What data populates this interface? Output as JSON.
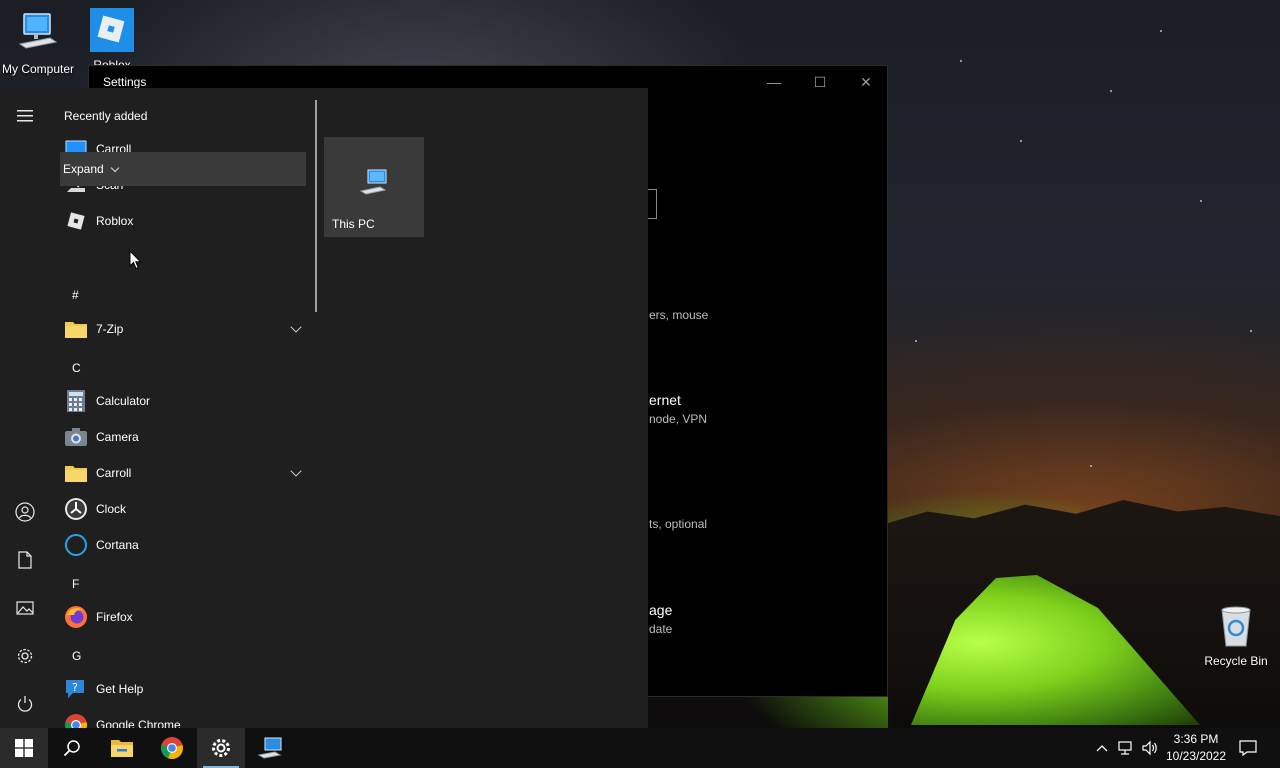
{
  "desktop": {
    "icons": [
      {
        "label": "My Computer",
        "icon": "monitor-icon"
      },
      {
        "label": "Roblox",
        "icon": "roblox-icon"
      },
      {
        "label": "Recycle Bin",
        "icon": "recycle-bin-icon"
      }
    ]
  },
  "settings_window": {
    "title": "Settings",
    "controls": {
      "minimize": "—",
      "maximize": "☐",
      "close": "✕"
    },
    "fragments": [
      "ers, mouse",
      "ernet",
      "node, VPN",
      "ts, optional",
      "age",
      "date"
    ]
  },
  "start_menu": {
    "rail": [
      "hamburger-menu-icon",
      "user-icon",
      "documents-icon",
      "pictures-icon",
      "settings-gear-icon",
      "power-icon"
    ],
    "recently_added_label": "Recently added",
    "recent": [
      {
        "label": "Carroll",
        "icon": "monitor-icon"
      },
      {
        "label": "Scan",
        "icon": "scanner-icon"
      },
      {
        "label": "Roblox",
        "icon": "roblox-icon"
      }
    ],
    "expand_label": "Expand",
    "groups": [
      {
        "letter": "#",
        "items": [
          {
            "label": "7-Zip",
            "icon": "folder-icon",
            "expandable": true
          }
        ]
      },
      {
        "letter": "C",
        "items": [
          {
            "label": "Calculator",
            "icon": "calculator-icon",
            "expandable": false
          },
          {
            "label": "Camera",
            "icon": "camera-icon",
            "expandable": false
          },
          {
            "label": "Carroll",
            "icon": "folder-icon",
            "expandable": true
          },
          {
            "label": "Clock",
            "icon": "clock-icon",
            "expandable": false
          },
          {
            "label": "Cortana",
            "icon": "cortana-icon",
            "expandable": false
          }
        ]
      },
      {
        "letter": "F",
        "items": [
          {
            "label": "Firefox",
            "icon": "firefox-icon",
            "expandable": false
          }
        ]
      },
      {
        "letter": "G",
        "items": [
          {
            "label": "Get Help",
            "icon": "help-icon",
            "expandable": false
          },
          {
            "label": "Google Chrome",
            "icon": "chrome-icon",
            "expandable": false
          }
        ]
      }
    ],
    "tiles": [
      {
        "label": "This PC",
        "icon": "this-pc-icon"
      }
    ]
  },
  "taskbar": {
    "buttons": [
      "windows-start-icon",
      "search-icon",
      "file-explorer-icon",
      "chrome-icon",
      "settings-gear-icon",
      "remote-desktop-icon"
    ],
    "active": "settings-gear-icon",
    "tray": [
      "chevron-up-icon",
      "network-icon",
      "volume-icon"
    ],
    "time": "3:36 PM",
    "date": "10/23/2022",
    "notification_icon": "action-center-icon"
  }
}
